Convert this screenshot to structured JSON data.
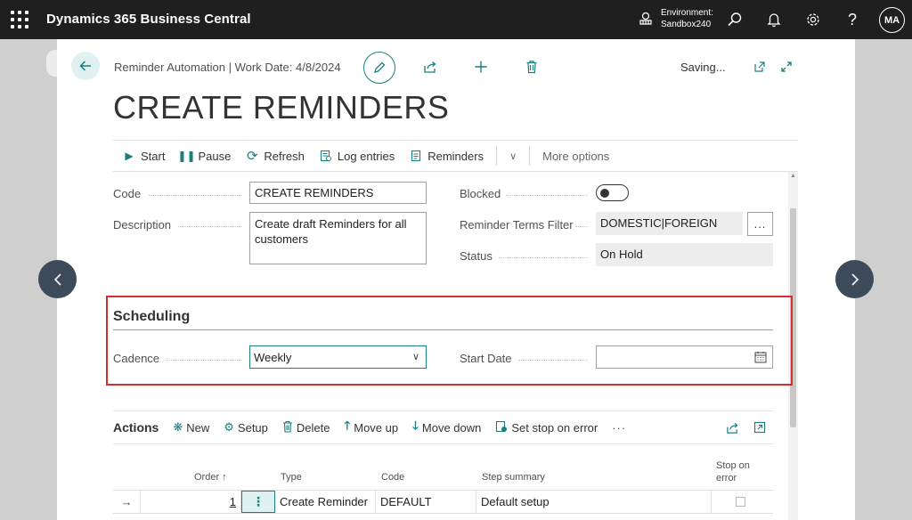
{
  "topbar": {
    "app_name": "Dynamics 365 Business Central",
    "environment_label": "Environment:",
    "environment_value": "Sandbox240",
    "avatar_initials": "MA"
  },
  "header": {
    "breadcrumb": "Reminder Automation | Work Date: 4/8/2024",
    "saving_status": "Saving...",
    "title": "CREATE REMINDERS"
  },
  "actionbar": {
    "start": "Start",
    "pause": "Pause",
    "refresh": "Refresh",
    "log_entries": "Log entries",
    "reminders": "Reminders",
    "more_options": "More options"
  },
  "general": {
    "code_label": "Code",
    "code_value": "CREATE REMINDERS",
    "description_label": "Description",
    "description_value": "Create draft Reminders for all customers",
    "blocked_label": "Blocked",
    "blocked_value": false,
    "terms_filter_label": "Reminder Terms Filter",
    "terms_filter_value": "DOMESTIC|FOREIGN",
    "assist_button_label": "...",
    "status_label": "Status",
    "status_value": "On Hold"
  },
  "scheduling": {
    "title": "Scheduling",
    "cadence_label": "Cadence",
    "cadence_value": "Weekly",
    "start_date_label": "Start Date",
    "start_date_value": "",
    "highlight_color": "#d32f2f"
  },
  "actions": {
    "title": "Actions",
    "new": "New",
    "setup": "Setup",
    "delete": "Delete",
    "move_up": "Move up",
    "move_down": "Move down",
    "set_stop_on_error": "Set stop on error",
    "more": "···",
    "columns": {
      "order": "Order ↑",
      "type": "Type",
      "code": "Code",
      "step_summary": "Step summary",
      "stop_on_error": "Stop on error"
    },
    "rows": [
      {
        "order": "1",
        "type": "Create Reminder",
        "code": "DEFAULT",
        "step_summary": "Default setup",
        "stop_on_error": false
      }
    ]
  },
  "colors": {
    "accent": "#1a7f7f",
    "topbar": "#1f1f1f",
    "nav_arrow": "#3c4a5a"
  }
}
